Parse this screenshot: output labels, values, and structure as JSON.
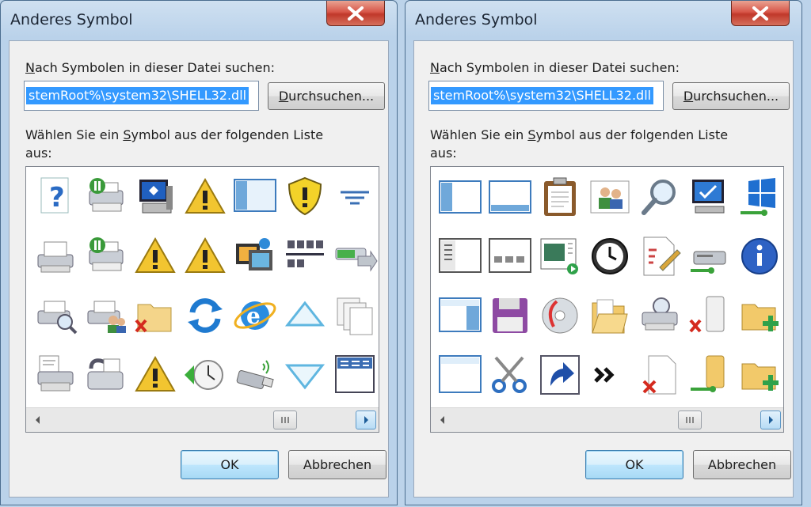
{
  "dialogs": [
    {
      "title": "Anderes Symbol",
      "find_label": "Nach Symbolen in dieser Datei suchen:",
      "path_value": "stemRoot%\\system32\\SHELL32.dll",
      "browse_label": "Durchsuchen...",
      "choose_label": "Wählen Sie ein Symbol aus der folgenden Liste aus:",
      "ok_label": "OK",
      "cancel_label": "Abbrechen",
      "icons": [
        "help-question-icon",
        "printer-paused-icon",
        "my-computer-icon",
        "warning-icon",
        "panel-layout-icon",
        "shield-warning-icon",
        "filter-lines-icon",
        "fax-printer-icon",
        "printer-paused-icon",
        "warning-icon",
        "warning-icon",
        "media-files-icon",
        "network-tiles-icon",
        "progress-arrow-icon",
        "printer-search-icon",
        "printer-users-icon",
        "folder-delete-icon",
        "sync-arrows-icon",
        "internet-explorer-icon",
        "triangle-up-outline-icon",
        "copy-pages-icon",
        "printer-document-icon",
        "fax-machine-icon",
        "warning-icon",
        "clock-restore-icon",
        "usb-stick-icon",
        "triangle-down-outline-icon",
        "window-toolbar-icon"
      ]
    },
    {
      "title": "Anderes Symbol",
      "find_label": "Nach Symbolen in dieser Datei suchen:",
      "path_value": "stemRoot%\\system32\\SHELL32.dll",
      "browse_label": "Durchsuchen...",
      "choose_label": "Wählen Sie ein Symbol aus der folgenden Liste aus:",
      "ok_label": "OK",
      "cancel_label": "Abbrechen",
      "icons": [
        "panel-left-icon",
        "panel-bottom-icon",
        "clipboard-icon",
        "users-icon",
        "magnifier-icon",
        "network-computer-icon",
        "windows-network-icon",
        "list-view-icon",
        "thumbnail-view-icon",
        "media-player-icon",
        "clock-icon",
        "document-edit-icon",
        "network-drive-icon",
        "info-icon",
        "panel-left-blue-icon",
        "floppy-disk-icon",
        "cd-disc-icon",
        "open-folder-icon",
        "network-printer-icon",
        "network-drive-delete-icon",
        "folder-add-icon",
        "panel-window-icon",
        "scissors-icon",
        "shortcut-arrow-icon",
        "double-chevron-icon",
        "document-delete-icon",
        "network-folder-icon",
        "folder-add-icon"
      ]
    }
  ],
  "colors": {
    "selection": "#3399ff",
    "frame": "#bad2ea",
    "close_button": "#c0382a"
  }
}
